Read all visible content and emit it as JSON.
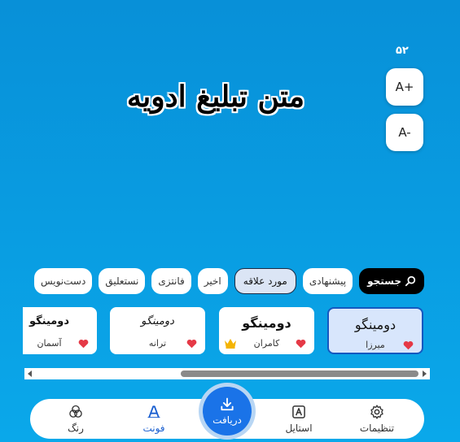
{
  "size_control": {
    "font_size": "۵۲",
    "increase_label": "A+",
    "decrease_label": "A-"
  },
  "preview": {
    "text": "متن تبلیغ ادویه"
  },
  "filters": {
    "search_label": "جستجو",
    "chips": [
      {
        "label": "پیشنهادی",
        "active": false
      },
      {
        "label": "مورد علاقه",
        "active": true
      },
      {
        "label": "اخیر",
        "active": false
      },
      {
        "label": "فانتزی",
        "active": false
      },
      {
        "label": "نستعلیق",
        "active": false
      },
      {
        "label": "دست‌نویس",
        "active": false
      }
    ]
  },
  "font_cards": [
    {
      "sample": "دومینگو",
      "name": "میرزا",
      "favorite": true,
      "premium": false,
      "selected": true
    },
    {
      "sample": "دومینگو",
      "name": "کامران",
      "favorite": true,
      "premium": true,
      "selected": false
    },
    {
      "sample": "دومینگو",
      "name": "ترانه",
      "favorite": true,
      "premium": false,
      "selected": false
    },
    {
      "sample": "دومینگو",
      "name": "آسمان",
      "favorite": true,
      "premium": false,
      "selected": false
    }
  ],
  "nav": {
    "settings_label": "تنظیمات",
    "style_label": "استایل",
    "download_label": "دریافت",
    "font_label": "فونت",
    "color_label": "رنگ"
  },
  "colors": {
    "accent": "#1a73e8",
    "favorite": "#e53946",
    "premium": "#f4b400"
  }
}
